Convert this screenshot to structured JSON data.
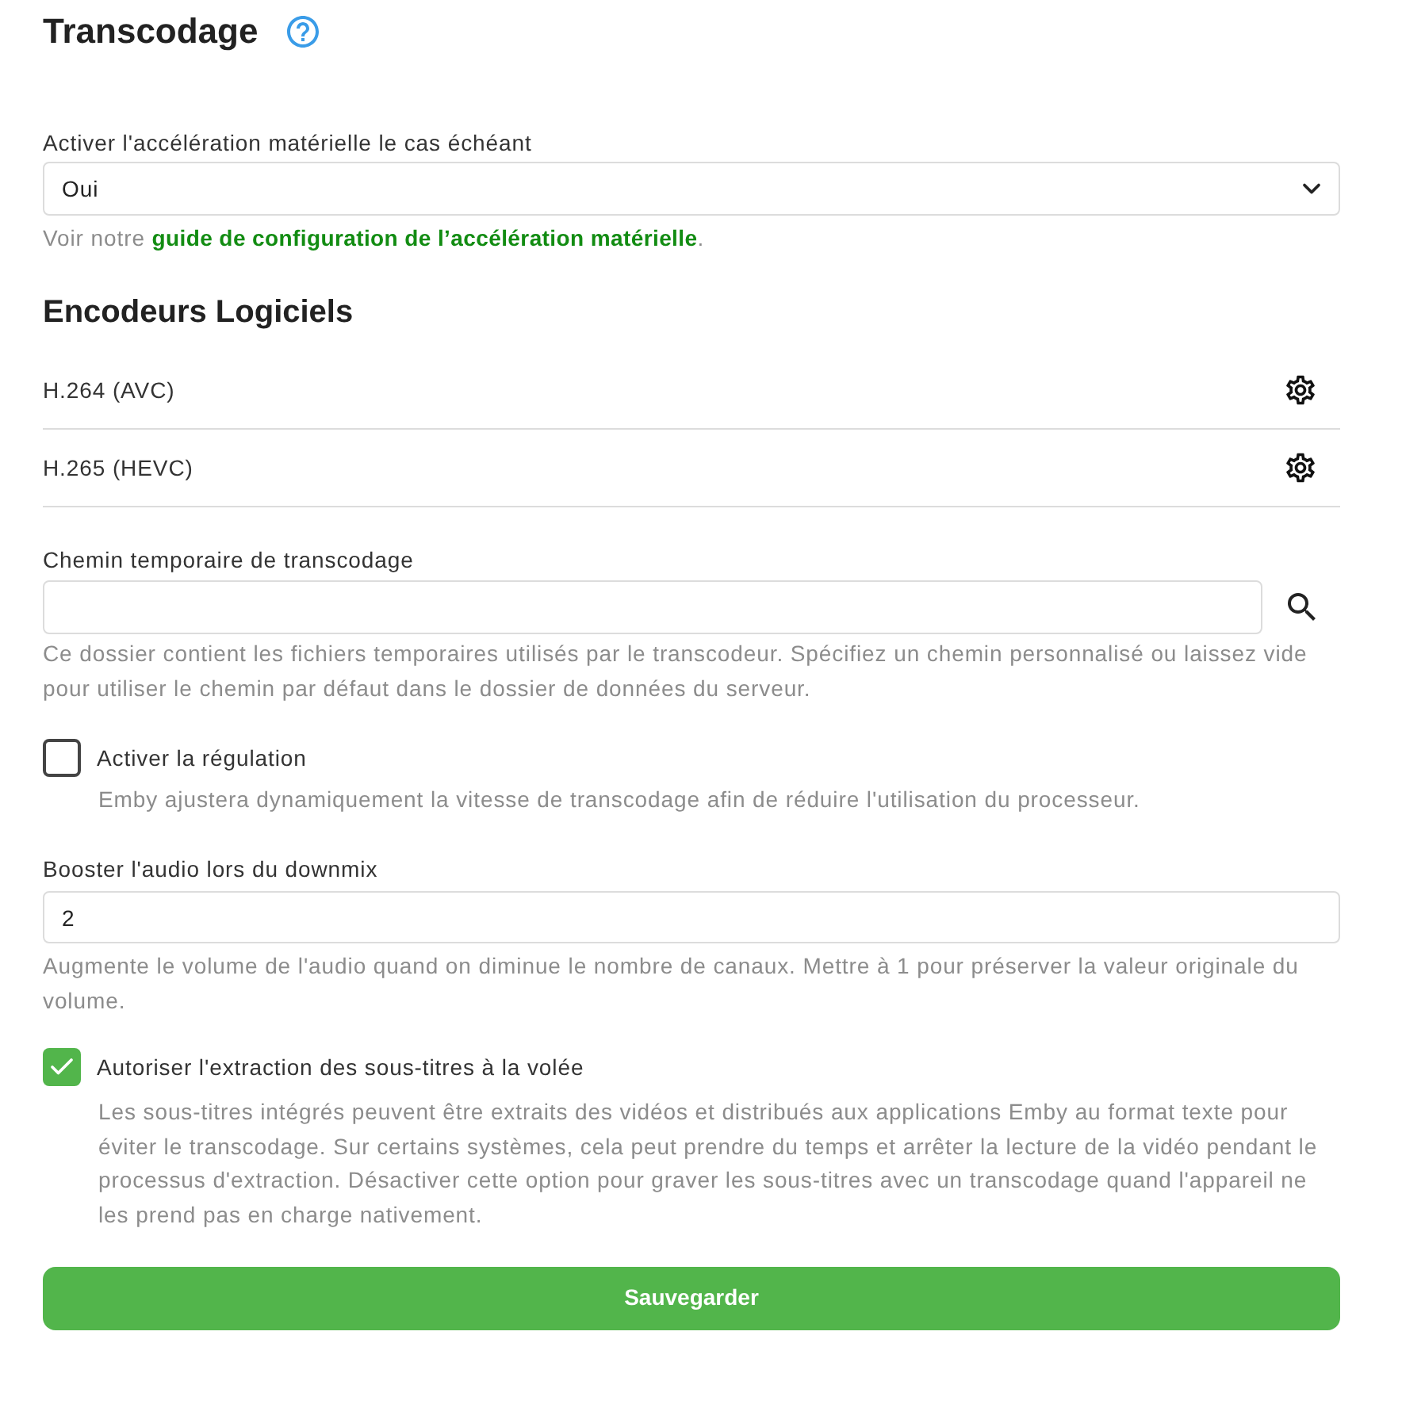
{
  "page": {
    "title": "Transcodage"
  },
  "hardware_acceleration": {
    "label": "Activer l'accélération matérielle le cas échéant",
    "value": "Oui",
    "hint_before": "Voir notre ",
    "link": "guide de configuration de l’accélération matérielle",
    "hint_after": "."
  },
  "software_encoders": {
    "title": "Encodeurs Logiciels",
    "items": [
      {
        "name": "H.264 (AVC)"
      },
      {
        "name": "H.265 (HEVC)"
      }
    ]
  },
  "settings": [
    {
      "kind": "path",
      "label": "Chemin temporaire de transcodage",
      "description": "Ce dossier contient les fichiers temporaires utilisés par le transcodeur. Spécifiez un chemin personnalisé ou laissez vide pour utiliser le chemin par défaut dans le dossier de données du serveur."
    },
    {
      "kind": "checkbox",
      "label": "Activer la régulation",
      "checked": false,
      "description": "Emby ajustera dynamiquement la vitesse de transcodage afin de réduire l'utilisation du processeur."
    },
    {
      "kind": "number",
      "label": "Booster l'audio lors du downmix",
      "value": "2",
      "description": "Augmente le volume de l'audio quand on diminue le nombre de canaux. Mettre à 1 pour préserver la valeur originale du volume."
    },
    {
      "kind": "checkbox",
      "label": "Autoriser l'extraction des sous-titres à la volée",
      "checked": true,
      "description": "Les sous-titres intégrés peuvent être extraits des vidéos et distribués aux applications Emby au format texte pour éviter le transcodage. Sur certains systèmes, cela peut prendre du temps et arrêter la lecture de la vidéo pendant le processus d'extraction. Désactiver cette option pour graver les sous-titres avec un transcodage quand l'appareil ne les prend pas en charge nativement."
    }
  ],
  "save_button": {
    "label": "Sauvegarder"
  }
}
